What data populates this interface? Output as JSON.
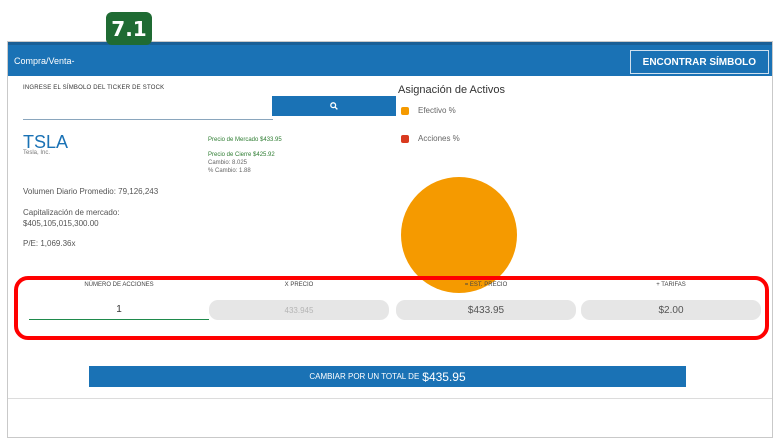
{
  "badge": "7.1",
  "header": {
    "title": "Compra/Venta-",
    "find_symbol_label": "ENCONTRAR SÍMBOLO"
  },
  "ticker": {
    "label": "INGRESE EL SÍMBOLO DEL TICKER DE STOCK",
    "value": "",
    "search_icon": "search-icon"
  },
  "quote": {
    "symbol": "TSLA",
    "company": "Tesla, Inc.",
    "market_price": "Precio de Mercado $433.95",
    "close_price": "Precio de Cierre $425.92",
    "change": "Cambio: 8.025",
    "pct_change": "% Cambio: 1.88"
  },
  "stats": {
    "avg_volume": "Volumen Diario Promedio: 79,126,243",
    "market_cap_label": "Capitalización de mercado:",
    "market_cap_value": "$405,105,015,300.00",
    "pe": "P/E: 1,069.36x"
  },
  "allocation": {
    "title": "Asignación de Activos",
    "legend": [
      {
        "label": "Efectivo %",
        "color": "#f59a00"
      },
      {
        "label": "Acciones %",
        "color": "#d93a1f"
      }
    ]
  },
  "chart_data": {
    "type": "pie",
    "categories": [
      "Efectivo %",
      "Acciones %"
    ],
    "values": [
      100,
      0
    ],
    "colors": [
      "#f59a00",
      "#d93a1f"
    ],
    "title": "Asignación de Activos"
  },
  "trade": {
    "qty_header": "NÚMERO DE ACCIONES",
    "price_header": "X PRECIO",
    "est_header": "= EST. PRECIO",
    "fees_header": "+ TARIFAS",
    "qty_value": "1",
    "price_value": "433.945",
    "est_value": "$433.95",
    "fees_value": "$2.00"
  },
  "submit": {
    "prefix": "CAMBIAR POR UN TOTAL DE",
    "total": "$435.95"
  },
  "colors": {
    "primary": "#1a72b5",
    "highlight": "#ff0000",
    "positive": "#2e7d32"
  }
}
